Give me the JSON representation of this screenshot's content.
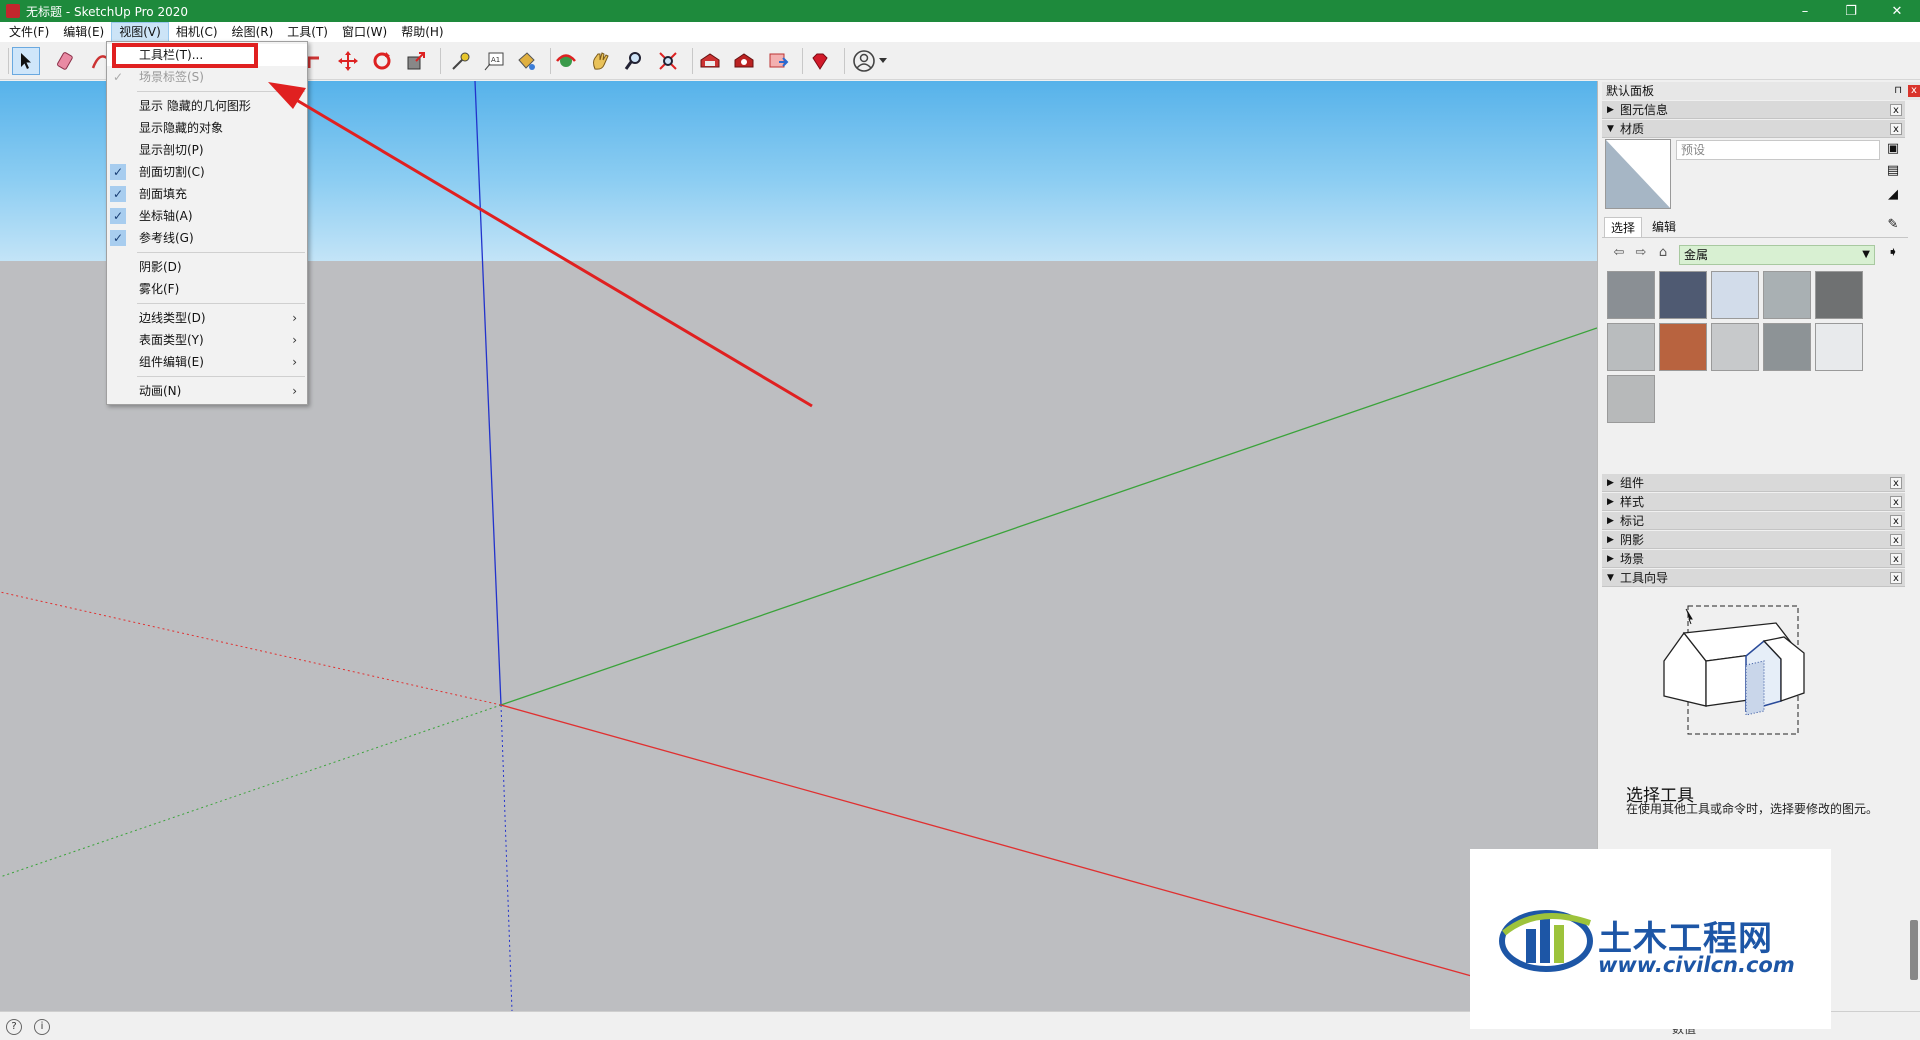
{
  "window": {
    "title": "无标题 - SketchUp Pro 2020",
    "minimize": "–",
    "maximize": "❐",
    "close": "✕"
  },
  "menubar": [
    "文件(F)",
    "编辑(E)",
    "视图(V)",
    "相机(C)",
    "绘图(R)",
    "工具(T)",
    "窗口(W)",
    "帮助(H)"
  ],
  "view_menu": {
    "items": [
      {
        "label": "工具栏(T)...",
        "checked": false,
        "disabled": false,
        "submenu": false
      },
      {
        "label": "场景标签(S)",
        "checked": true,
        "disabled": true,
        "submenu": false
      },
      {
        "label": "显示 隐藏的几何图形",
        "checked": false,
        "disabled": false,
        "submenu": false
      },
      {
        "label": "显示隐藏的对象",
        "checked": false,
        "disabled": false,
        "submenu": false
      },
      {
        "label": "显示剖切(P)",
        "checked": false,
        "disabled": false,
        "submenu": false
      },
      {
        "label": "剖面切割(C)",
        "checked": true,
        "disabled": false,
        "submenu": false
      },
      {
        "label": "剖面填充",
        "checked": true,
        "disabled": false,
        "submenu": false
      },
      {
        "label": "坐标轴(A)",
        "checked": true,
        "disabled": false,
        "submenu": false
      },
      {
        "label": "参考线(G)",
        "checked": true,
        "disabled": false,
        "submenu": false
      },
      {
        "label": "阴影(D)",
        "checked": false,
        "disabled": false,
        "submenu": false
      },
      {
        "label": "雾化(F)",
        "checked": false,
        "disabled": false,
        "submenu": false
      },
      {
        "label": "边线类型(D)",
        "checked": false,
        "disabled": false,
        "submenu": true
      },
      {
        "label": "表面类型(Y)",
        "checked": false,
        "disabled": false,
        "submenu": true
      },
      {
        "label": "组件编辑(E)",
        "checked": false,
        "disabled": false,
        "submenu": true
      },
      {
        "label": "动画(N)",
        "checked": false,
        "disabled": false,
        "submenu": true
      }
    ],
    "check_glyph": "✓",
    "arrow_glyph": "›"
  },
  "toolbar_icons": [
    "select-icon",
    "eraser-icon",
    "paint-icon",
    "push-pull-icon",
    "move-icon",
    "rotate-icon",
    "scale-icon",
    "tape-measure-icon",
    "text-icon",
    "paint-bucket-icon",
    "orbit-icon",
    "pan-icon",
    "zoom-icon",
    "zoom-extents-icon",
    "warehouse-icon",
    "extension-warehouse-icon",
    "layout-icon",
    "ruby-icon",
    "account-icon"
  ],
  "toolbar_text_icon": "A1",
  "panel": {
    "title": "默认面板",
    "pin": "⊓",
    "close": "x",
    "entity_info": "图元信息",
    "materials": "材质",
    "material_name_placeholder": "预设",
    "tabs": [
      "选择",
      "编辑"
    ],
    "collection": "金属",
    "sections": [
      "组件",
      "样式",
      "标记",
      "阴影",
      "场景",
      "工具向导"
    ],
    "guide_title": "选择工具",
    "guide_desc": "在使用其他工具或命令时，选择要修改的图元。"
  },
  "materials_swatches": [
    {
      "name": "swatch-diamond-plate",
      "color": "#8a8f94"
    },
    {
      "name": "swatch-blue-mesh",
      "color": "#4f5a72"
    },
    {
      "name": "swatch-light-blue-foil",
      "color": "#d2dcea"
    },
    {
      "name": "swatch-brushed-silver",
      "color": "#a9b0b3"
    },
    {
      "name": "swatch-dark-steel",
      "color": "#6f7172"
    },
    {
      "name": "swatch-corrugated",
      "color": "#b9bcbe"
    },
    {
      "name": "swatch-rusty",
      "color": "#b8633f"
    },
    {
      "name": "swatch-tread-plate",
      "color": "#c7c9cb"
    },
    {
      "name": "swatch-galvanized",
      "color": "#8d9396"
    },
    {
      "name": "swatch-white-metal",
      "color": "#e8eaec"
    },
    {
      "name": "swatch-aluminum",
      "color": "#b7b9ba"
    }
  ],
  "colors": {
    "titlebar": "#1e8a3c",
    "axis_red": "#e03030",
    "axis_green": "#3aa33a",
    "axis_blue": "#2233cc",
    "annotation": "#e02020",
    "watermark": "#1d56a6"
  },
  "status": {
    "icon1": "?",
    "icon2": "i",
    "field_label": "数值"
  },
  "watermark": {
    "cn": "土木工程网",
    "url": "www.civilcn.com"
  }
}
